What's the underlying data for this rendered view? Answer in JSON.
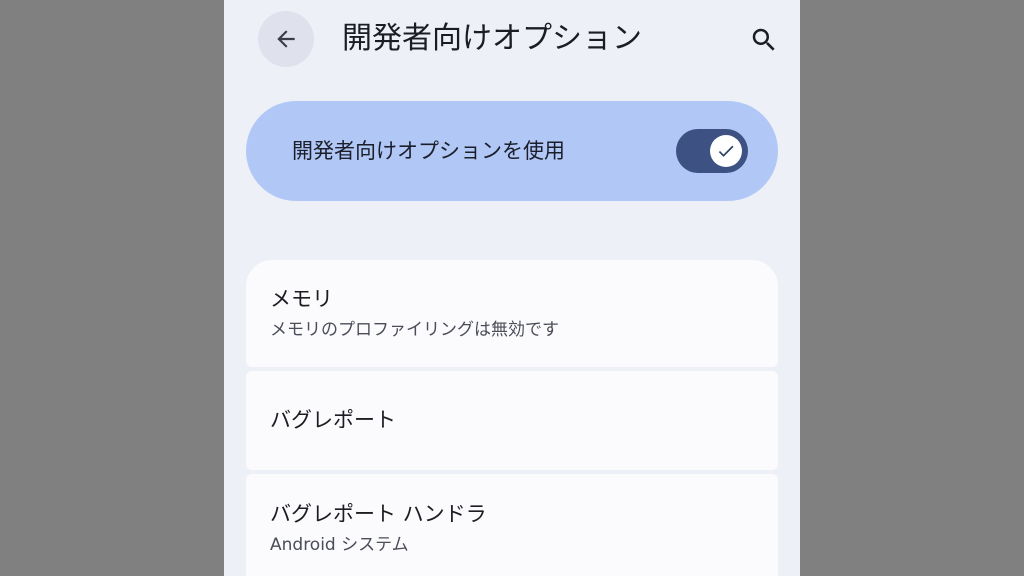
{
  "header": {
    "back_icon": "arrow-left-icon",
    "title": "開発者向けオプション",
    "search_icon": "search-icon"
  },
  "master_switch": {
    "label": "開発者向けオプションを使用",
    "enabled": true,
    "check_icon": "check-icon"
  },
  "settings": {
    "items": [
      {
        "title": "メモリ",
        "summary": "メモリのプロファイリングは無効です"
      },
      {
        "title": "バグレポート"
      },
      {
        "title": "バグレポート ハンドラ",
        "summary": "Android システム"
      }
    ]
  },
  "colors": {
    "background_outer": "#808080",
    "screen_background": "#eef0f8",
    "master_switch_bg": "#b1c7f5",
    "toggle_track": "#3d5283",
    "card_background": "#fbfbfe"
  }
}
